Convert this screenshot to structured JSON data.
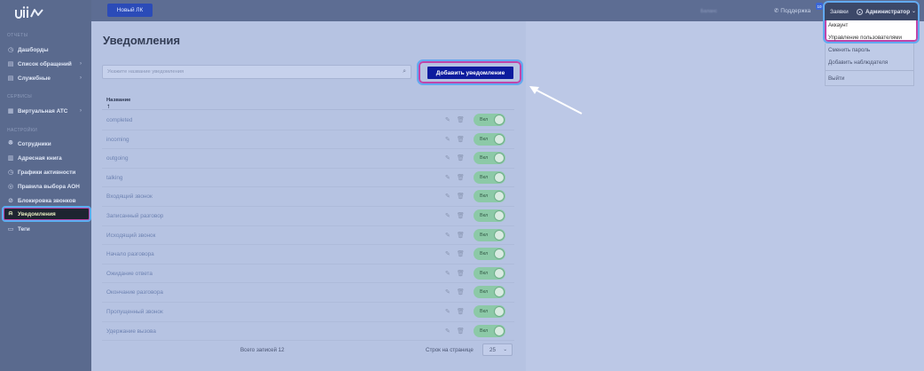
{
  "brand": {
    "logo_text": "uiis"
  },
  "sidebar": {
    "sections": [
      {
        "title": "Отчеты"
      },
      {
        "title": "Сервисы"
      },
      {
        "title": "Настройки"
      }
    ],
    "items": [
      {
        "label": "Дашборды",
        "icon": "clock-icon"
      },
      {
        "label": "Список обращений",
        "icon": "list-icon",
        "chevron": "›"
      },
      {
        "label": "Служебные",
        "icon": "list-icon",
        "chevron": "›"
      },
      {
        "label": "Виртуальная АТС",
        "icon": "grid-icon",
        "chevron": "›"
      },
      {
        "label": "Сотрудники",
        "icon": "users-icon"
      },
      {
        "label": "Адресная книга",
        "icon": "book-icon"
      },
      {
        "label": "Графики активности",
        "icon": "clock-icon"
      },
      {
        "label": "Правила выбора АОН",
        "icon": "globe-icon"
      },
      {
        "label": "Блокировка звонков",
        "icon": "block-icon"
      },
      {
        "label": "Уведомления",
        "icon": "bell-icon",
        "active": true
      },
      {
        "label": "Теги",
        "icon": "tag-icon"
      }
    ]
  },
  "topbar": {
    "new_lk": "Новый ЛК",
    "blurred_left": "Баланс",
    "blurred_mid": "",
    "support": "Поддержка",
    "support_badge": "10",
    "requests": "Заявки",
    "user": "Администратор"
  },
  "user_menu": {
    "items": [
      "Аккаунт",
      "Управление пользователями",
      "Сменить пароль",
      "Добавить наблюдателя",
      "Выйти"
    ]
  },
  "main": {
    "title": "Уведомления",
    "search_placeholder": "Укажите название уведомления",
    "add_button": "Добавить уведомление",
    "column_name": "Название",
    "toggle_label": "Вкл",
    "rows": [
      "completed",
      "incoming",
      "outgoing",
      "talking",
      "Входящий звонок",
      "Записанный разговор",
      "Исходящий звонок",
      "Начало разговора",
      "Ожидание ответа",
      "Окончание разговора",
      "Пропущенный звонок",
      "Удержание вызова"
    ],
    "total": "Всего записей 12",
    "rows_per_page_label": "Строк на странице",
    "rows_per_page": "25"
  }
}
